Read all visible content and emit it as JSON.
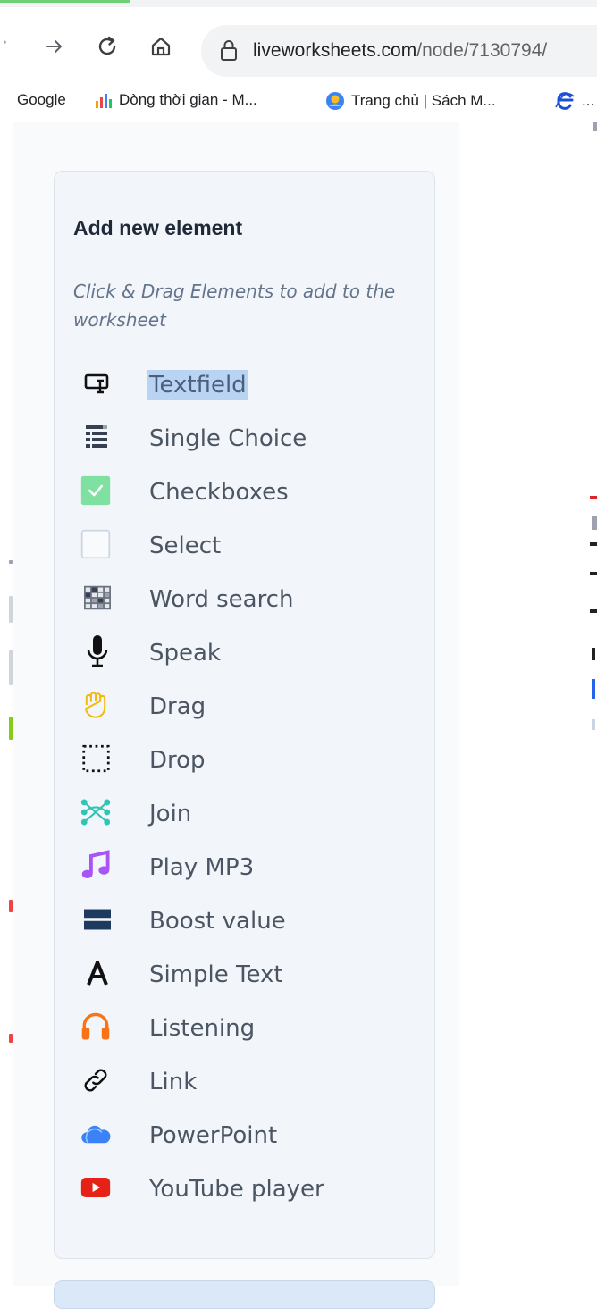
{
  "browser": {
    "url_host": "liveworksheets.com",
    "url_path": "/node/7130794/",
    "bookmarks": [
      {
        "label": "Google",
        "icon": "none"
      },
      {
        "label": "Dòng thời gian - M...",
        "icon": "timeline-icon"
      },
      {
        "label": "Trang chủ | Sách M...",
        "icon": "globe-avatar-icon"
      },
      {
        "label": "...",
        "icon": "e-logo-icon"
      }
    ]
  },
  "panel": {
    "title": "Add new element",
    "hint": "Click & Drag Elements to add to the worksheet",
    "items": [
      {
        "label": "Textfield",
        "icon": "textfield-icon",
        "selected": true
      },
      {
        "label": "Single Choice",
        "icon": "list-icon"
      },
      {
        "label": "Checkboxes",
        "icon": "checkbox-checked-icon"
      },
      {
        "label": "Select",
        "icon": "select-box-icon"
      },
      {
        "label": "Word search",
        "icon": "grid-icon"
      },
      {
        "label": "Speak",
        "icon": "microphone-icon"
      },
      {
        "label": "Drag",
        "icon": "hand-icon"
      },
      {
        "label": "Drop",
        "icon": "dotted-square-icon"
      },
      {
        "label": "Join",
        "icon": "join-icon"
      },
      {
        "label": "Play MP3",
        "icon": "music-note-icon"
      },
      {
        "label": "Boost value",
        "icon": "boost-bars-icon"
      },
      {
        "label": "Simple Text",
        "icon": "letter-a-icon"
      },
      {
        "label": "Listening",
        "icon": "headphones-icon"
      },
      {
        "label": "Link",
        "icon": "link-icon"
      },
      {
        "label": "PowerPoint",
        "icon": "cloud-icon"
      },
      {
        "label": "YouTube player",
        "icon": "youtube-icon"
      }
    ]
  },
  "colors": {
    "accent_selection": "#b9d4f3",
    "checkbox_green": "#7ee0a1",
    "drag_hand": "#f2b90f",
    "join_teal": "#2ec4b6",
    "music_purple": "#a855f7",
    "boost_navy": "#1e3a5f",
    "headphones_orange": "#f97316",
    "cloud_blue": "#3b82f6",
    "youtube_red": "#e62117"
  }
}
